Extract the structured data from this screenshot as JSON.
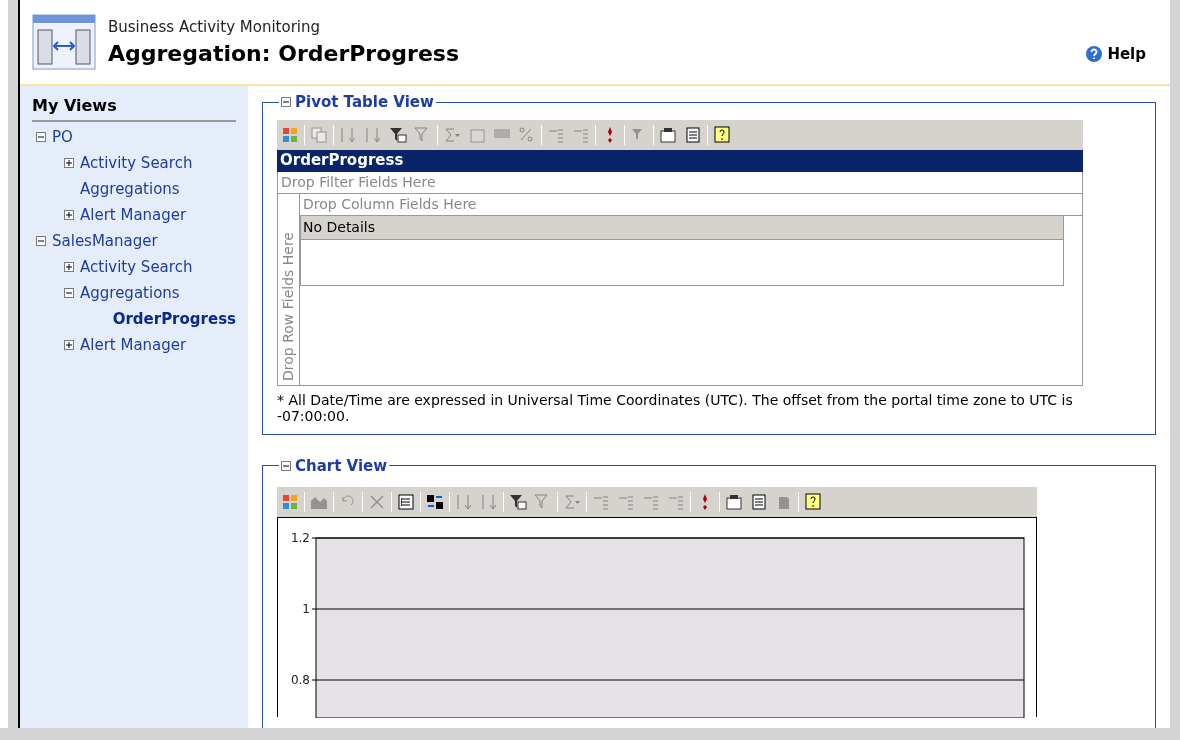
{
  "header": {
    "subtitle": "Business Activity Monitoring",
    "title": "Aggregation: OrderProgress",
    "help": "Help"
  },
  "sidebar": {
    "title": "My Views",
    "items": [
      {
        "label": "PO",
        "expanded": true,
        "selected": false,
        "children": [
          {
            "label": "Activity Search",
            "expanded": false,
            "selected": false
          },
          {
            "label": "Aggregations",
            "selected": false
          },
          {
            "label": "Alert Manager",
            "expanded": false,
            "selected": false
          }
        ]
      },
      {
        "label": "SalesManager",
        "expanded": true,
        "selected": false,
        "children": [
          {
            "label": "Activity Search",
            "expanded": false,
            "selected": false
          },
          {
            "label": "Aggregations",
            "expanded": true,
            "selected": false,
            "children": [
              {
                "label": "OrderProgress",
                "selected": true
              }
            ]
          },
          {
            "label": "Alert Manager",
            "expanded": false,
            "selected": false
          }
        ]
      }
    ]
  },
  "pivot_section": {
    "title": "Pivot Table View",
    "expanded": true,
    "table_title": "OrderProgress",
    "filter_drop": "Drop Filter Fields Here",
    "column_drop": "Drop Column Fields Here",
    "row_drop": "Drop Row Fields Here",
    "details": "No Details",
    "note": "* All Date/Time are expressed in Universal Time Coordinates (UTC). The offset from the portal time zone to UTC is -07:00:00."
  },
  "chart_section": {
    "title": "Chart View",
    "expanded": true,
    "y_axis_labels": [
      "1.2",
      "1",
      "0.8"
    ]
  }
}
